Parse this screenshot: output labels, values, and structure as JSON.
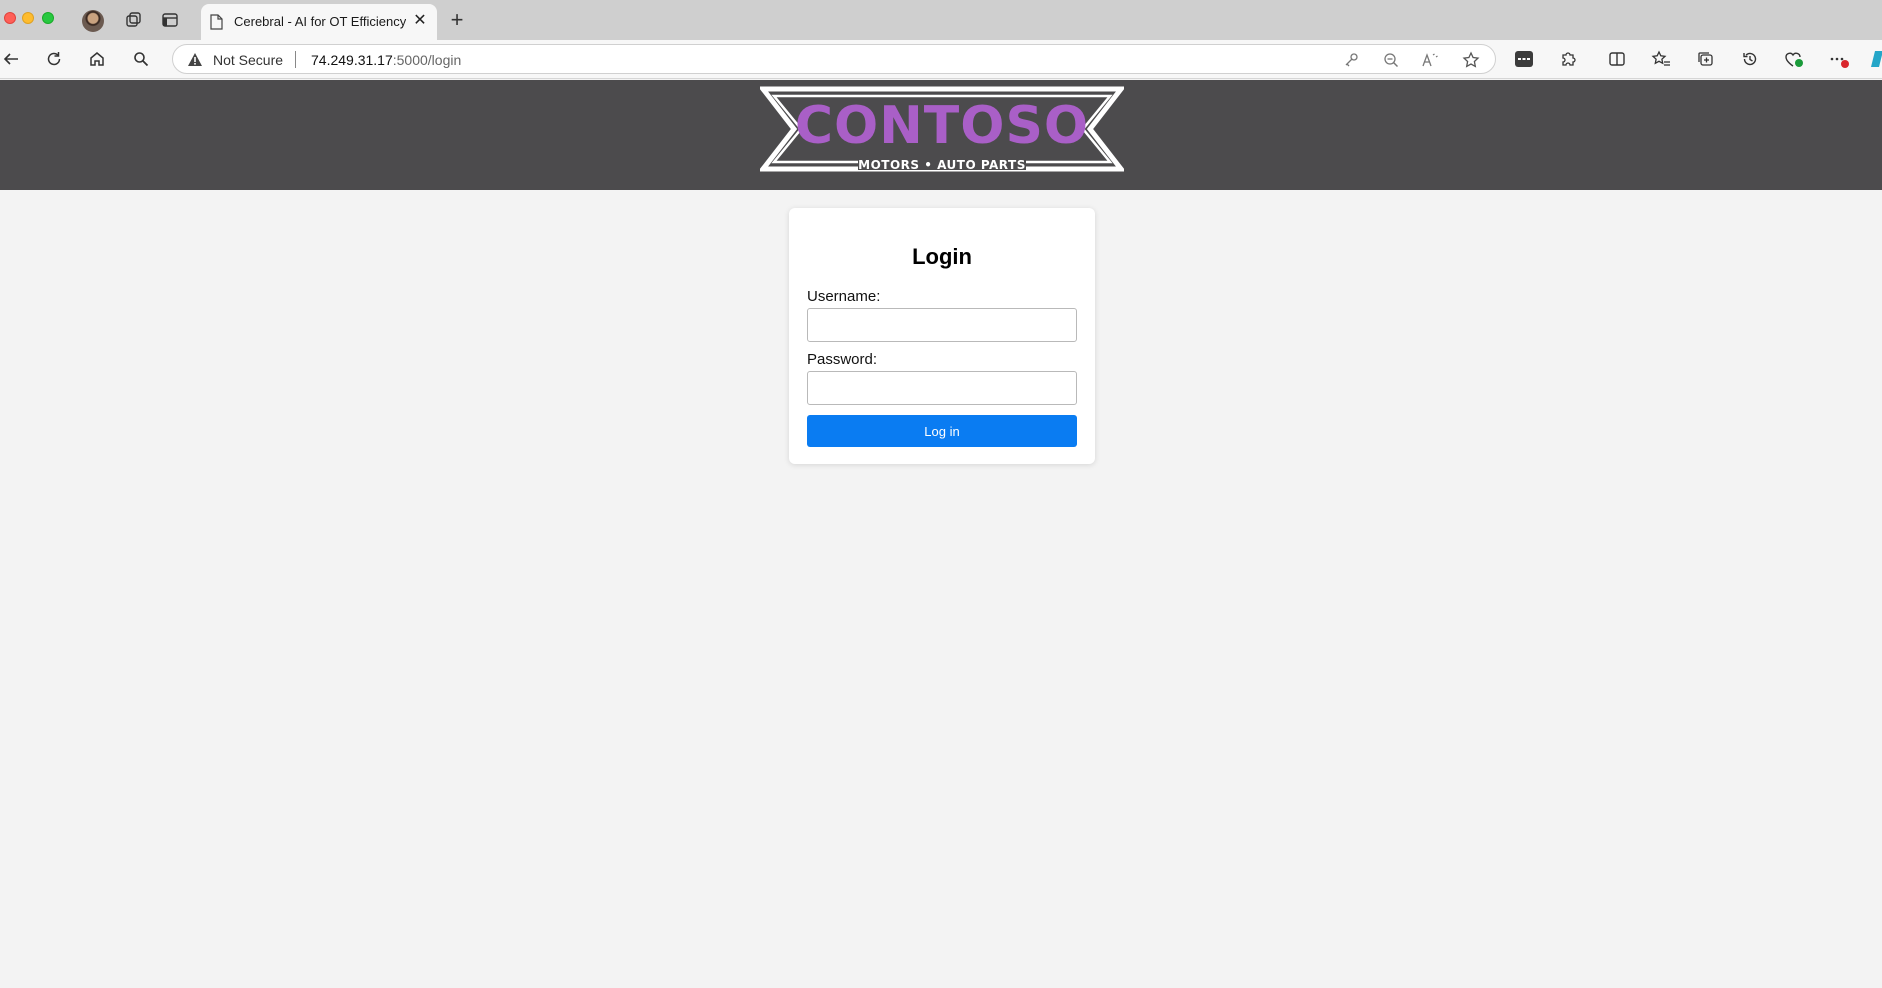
{
  "browser": {
    "tab_title": "Cerebral - AI for OT Efficiency",
    "tab_close": "✕",
    "new_tab": "+",
    "security_label": "Not Secure",
    "url_host": "74.249.31.17",
    "url_rest": ":5000/login"
  },
  "header": {
    "logo_title": "CONTOSO",
    "logo_subtitle": "MOTORS • AUTO PARTS",
    "logo_color": "#a95fc7",
    "background": "#4c4b4d"
  },
  "login": {
    "title": "Login",
    "username_label": "Username:",
    "username_value": "",
    "password_label": "Password:",
    "password_value": "",
    "submit_label": "Log in",
    "button_color": "#0a7cf2"
  }
}
